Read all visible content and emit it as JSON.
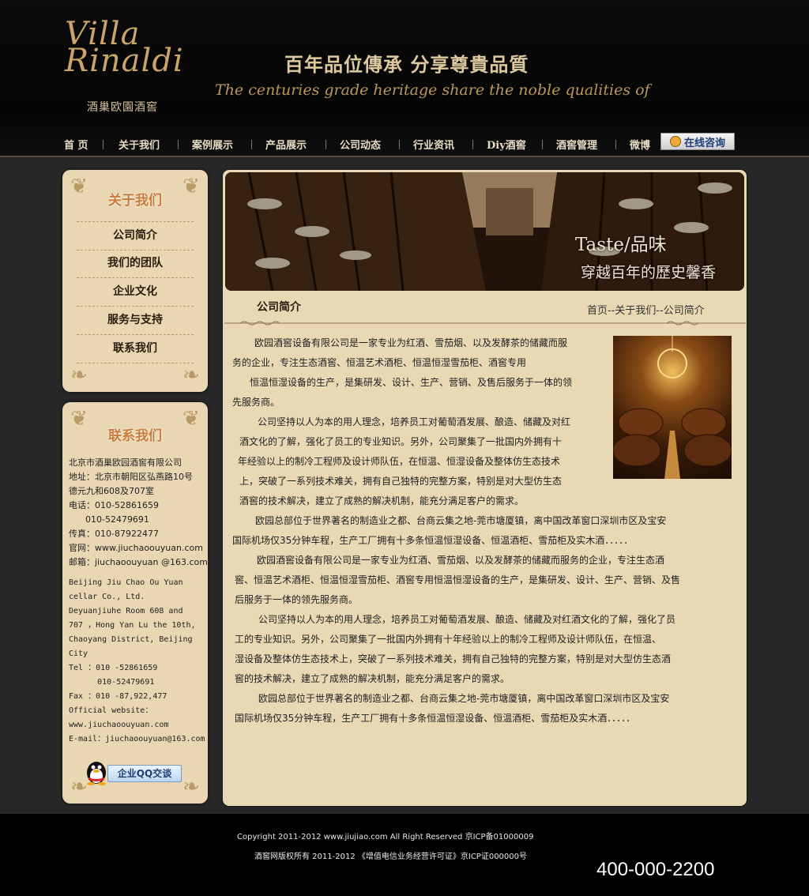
{
  "header": {
    "logo_script_line1": "Villa",
    "logo_script_line2": "Rinaldi",
    "logo_cn": "酒巢欧園酒窖",
    "slogan_cn": "百年品位傳承 分享尊貴品質",
    "slogan_en": "The centuries grade heritage share the noble qualities of"
  },
  "nav": {
    "items": [
      "首 页",
      "关于我们",
      "案例展示",
      "产品展示",
      "公司动态",
      "行业资讯",
      "Diy酒窖",
      "酒窖管理",
      "微博"
    ],
    "consult_label": "在线咨询"
  },
  "sidebar": {
    "about_title": "关于我们",
    "about_items": [
      "公司简介",
      "我们的团队",
      "企业文化",
      "服务与支持",
      "联系我们"
    ],
    "contact_title": "联系我们",
    "contact_cn": [
      "北京市酒巢欧园酒窖有限公司",
      "地址：北京市朝阳区弘燕路10号",
      "德元九和608及707室",
      "电话：010-52861659",
      "      010-52479691",
      "传真：010-87922477",
      "官网：www.jiuchaoouyuan.com",
      "邮箱：jiuchaoouyuan @163.com"
    ],
    "contact_en": [
      "Beijing Jiu Chao Ou Yuan",
      "cellar Co., Ltd.",
      "Deyuanjiuhe Room 608 and",
      "707 ，Hong Yan Lu the 10th,",
      "Chaoyang District, Beijing",
      "City",
      "Tel ：010 -52861659",
      "      010-52479691",
      "Fax ：010 -87,922,477",
      "Official website：",
      "www.jiuchaoouyuan.com",
      "E-mail：jiuchaoouyuan@163.com"
    ],
    "qq_label": "企业QQ交谈"
  },
  "banner": {
    "line1": "Taste/品味",
    "line2": "穿越百年的歷史馨香"
  },
  "main": {
    "section_title": "公司简介",
    "breadcrumb": "首页--关于我们--公司简介",
    "paragraphs": [
      "欧园酒窖设备有限公司是一家专业为红酒、雪茄烟、以及发酵茶的储藏而服",
      "务的企业，专注生态酒窖、恒温艺术酒柜、恒温恒湿雪茄柜、酒窖专用",
      "恒温恒湿设备的生产，是集研发、设计、生产、营销、及售后服务于一体的领",
      "先服务商。",
      "公司坚持以人为本的用人理念，培养员工对葡萄酒发展、酿造、储藏及对红",
      "酒文化的了解，强化了员工的专业知识。另外，公司聚集了一批国内外拥有十",
      "年经验以上的制冷工程师及设计师队伍，在恒温、恒湿设备及整体仿生态技术",
      "上，突破了一系列技术难关，拥有自己独特的完整方案，特别是对大型仿生态",
      "酒窖的技术解决，建立了成熟的解决机制，能充分满足客户的需求。",
      "欧园总部位于世界著名的制造业之都、台商云集之地-莞市塘厦镇，离中国改革窗口深圳市区及宝安",
      "国际机场仅35分钟车程，生产工厂拥有十多条恒温恒湿设备、恒温酒柜、雪茄柜及实木酒．．．．．",
      "欧园酒窖设备有限公司是一家专业为红酒、雪茄烟、以及发酵茶的储藏而服务的企业，专注生态酒",
      "窖、恒温艺术酒柜、恒温恒湿雪茄柜、酒窖专用恒温恒湿设备的生产，是集研发、设计、生产、营销、及售",
      "后服务于一体的领先服务商。",
      "公司坚持以人为本的用人理念，培养员工对葡萄酒发展、酿造、储藏及对红酒文化的了解，强化了员",
      "工的专业知识。另外，公司聚集了一批国内外拥有十年经验以上的制冷工程师及设计师队伍，在恒温、",
      "湿设备及整体仿生态技术上，突破了一系列技术难关，拥有自己独特的完整方案，特别是对大型仿生态酒",
      "窖的技术解决，建立了成熟的解决机制，能充分满足客户的需求。",
      "欧园总部位于世界著名的制造业之都、台商云集之地-莞市塘厦镇，离中国改革窗口深圳市区及宝安",
      "国际机场仅35分钟车程，生产工厂拥有十多条恒温恒湿设备、恒温酒柜、雪茄柜及实木酒．．．．．"
    ]
  },
  "footer": {
    "copyright": "Copyright  2011-2012 www.jiujiao.com All Right Reserved   京ICP备01000009",
    "license": "酒窖网版权所有 2011-2012 《增值电信业务经营许可证》京ICP证000000号",
    "phone": "400-000-2200"
  },
  "colors": {
    "header_bg": "#050505",
    "page_bg": "#272727",
    "panel_bg": "#e9d7b3",
    "accent_gold": "#c9a56a"
  }
}
